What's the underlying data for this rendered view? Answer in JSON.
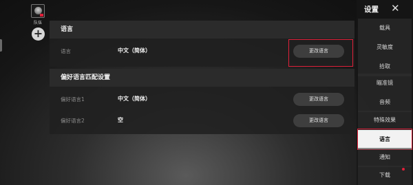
{
  "left_rail": {
    "team_label": "队伍",
    "add_symbol": "+"
  },
  "panels": {
    "language": {
      "title": "语言",
      "row": {
        "label": "语言",
        "value": "中文（简体）",
        "button": "更改语言"
      }
    },
    "preferred": {
      "title": "偏好语言匹配设置",
      "rows": [
        {
          "label": "偏好语言1",
          "value": "中文（简体）",
          "button": "更改语言"
        },
        {
          "label": "偏好语言2",
          "value": "空",
          "button": "更改语言"
        }
      ]
    }
  },
  "sidebar": {
    "title": "设置",
    "close_symbol": "✕",
    "items": [
      "载具",
      "灵敏度",
      "拾取",
      "瞄准镜",
      "音频",
      "特殊效果",
      "语言",
      "通知",
      "下载"
    ],
    "active": "语言"
  },
  "colors": {
    "highlight": "#e0203a",
    "active_item": "#f2f2f2"
  },
  "icons": [
    "avatar",
    "plus-icon",
    "close-icon",
    "notification-dot"
  ]
}
